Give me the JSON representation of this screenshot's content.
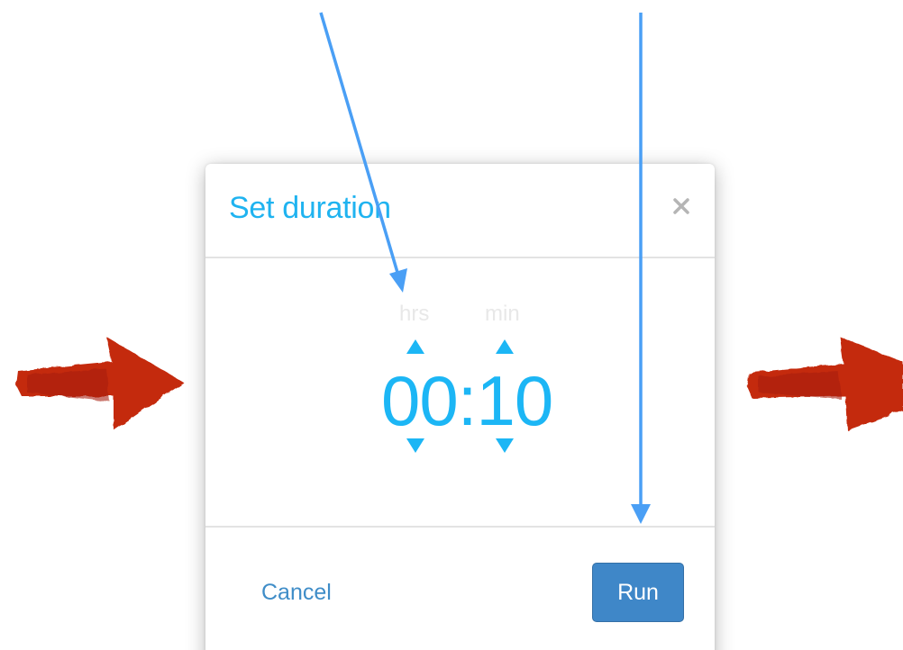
{
  "dialog": {
    "title": "Set duration",
    "close_icon": "close-icon"
  },
  "picker": {
    "hours_label": "hrs",
    "minutes_label": "min",
    "hours_value": "00",
    "separator": ":",
    "minutes_value": "10",
    "up_icon": "triangle-up-icon",
    "down_icon": "triangle-down-icon"
  },
  "footer": {
    "cancel_label": "Cancel",
    "run_label": "Run"
  },
  "colors": {
    "accent": "#1cb6f5",
    "button_primary": "#3f87c8",
    "link": "#3f8dc8",
    "annotation_blue": "#4a9ff5",
    "annotation_red": "#c42a10"
  }
}
